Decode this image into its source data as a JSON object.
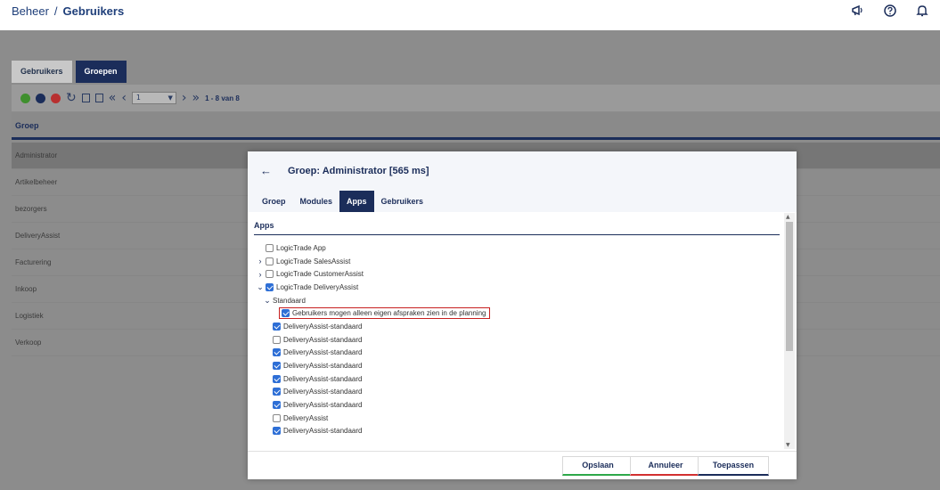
{
  "breadcrumb": {
    "parent": "Beheer",
    "separator": "/",
    "current": "Gebruikers"
  },
  "header_icons": [
    "megaphone-icon",
    "help-icon",
    "bell-icon"
  ],
  "tabs": [
    {
      "label": "Gebruikers",
      "active": false
    },
    {
      "label": "Groepen",
      "active": true
    }
  ],
  "toolbar": {
    "page_value": "1",
    "page_info": "1 - 8 van 8",
    "icons": [
      "add-icon",
      "edit-icon",
      "delete-icon",
      "refresh-icon",
      "columns-icon",
      "export-icon",
      "first-page-icon",
      "prev-page-icon",
      "next-page-icon",
      "last-page-icon"
    ]
  },
  "grid": {
    "header": "Groep",
    "rows": [
      "Administrator",
      "Artikelbeheer",
      "bezorgers",
      "DeliveryAssist",
      "Facturering",
      "Inkoop",
      "Logistiek",
      "Verkoop"
    ]
  },
  "modal": {
    "title": "Groep: Administrator [565 ms]",
    "back_icon": "back-arrow-icon",
    "tabs": [
      {
        "label": "Groep",
        "active": false
      },
      {
        "label": "Modules",
        "active": false
      },
      {
        "label": "Apps",
        "active": true
      },
      {
        "label": "Gebruikers",
        "active": false
      }
    ],
    "section_title": "Apps",
    "tree": [
      {
        "label": "LogicTrade App",
        "checked": false,
        "arrow": "",
        "indent": 0
      },
      {
        "label": "LogicTrade SalesAssist",
        "checked": false,
        "arrow": "›",
        "indent": 0
      },
      {
        "label": "LogicTrade CustomerAssist",
        "checked": false,
        "arrow": "›",
        "indent": 0
      },
      {
        "label": "LogicTrade DeliveryAssist",
        "checked": true,
        "arrow": "⌄",
        "indent": 0
      },
      {
        "label": "Standaard",
        "checked": null,
        "arrow": "⌄",
        "indent": 1
      },
      {
        "label": "Gebruikers mogen alleen eigen afspraken zien in de planning",
        "checked": true,
        "arrow": "",
        "indent": 2,
        "highlight": true
      },
      {
        "label": "DeliveryAssist-standaard",
        "checked": true,
        "arrow": "",
        "indent": 1
      },
      {
        "label": "DeliveryAssist-standaard",
        "checked": false,
        "arrow": "",
        "indent": 1
      },
      {
        "label": "DeliveryAssist-standaard",
        "checked": true,
        "arrow": "",
        "indent": 1
      },
      {
        "label": "DeliveryAssist-standaard",
        "checked": true,
        "arrow": "",
        "indent": 1
      },
      {
        "label": "DeliveryAssist-standaard",
        "checked": true,
        "arrow": "",
        "indent": 1
      },
      {
        "label": "DeliveryAssist-standaard",
        "checked": true,
        "arrow": "",
        "indent": 1
      },
      {
        "label": "DeliveryAssist-standaard",
        "checked": true,
        "arrow": "",
        "indent": 1
      },
      {
        "label": "DeliveryAssist",
        "checked": false,
        "arrow": "",
        "indent": 1
      },
      {
        "label": "DeliveryAssist-standaard",
        "checked": true,
        "arrow": "",
        "indent": 1
      }
    ],
    "buttons": {
      "save": "Opslaan",
      "cancel": "Annuleer",
      "apply": "Toepassen"
    }
  },
  "colors": {
    "navy": "#1b2d5a",
    "check_blue": "#2e6fd6",
    "highlight_red": "#c72020",
    "save_green": "#2ea84a",
    "cancel_red": "#d23030"
  }
}
